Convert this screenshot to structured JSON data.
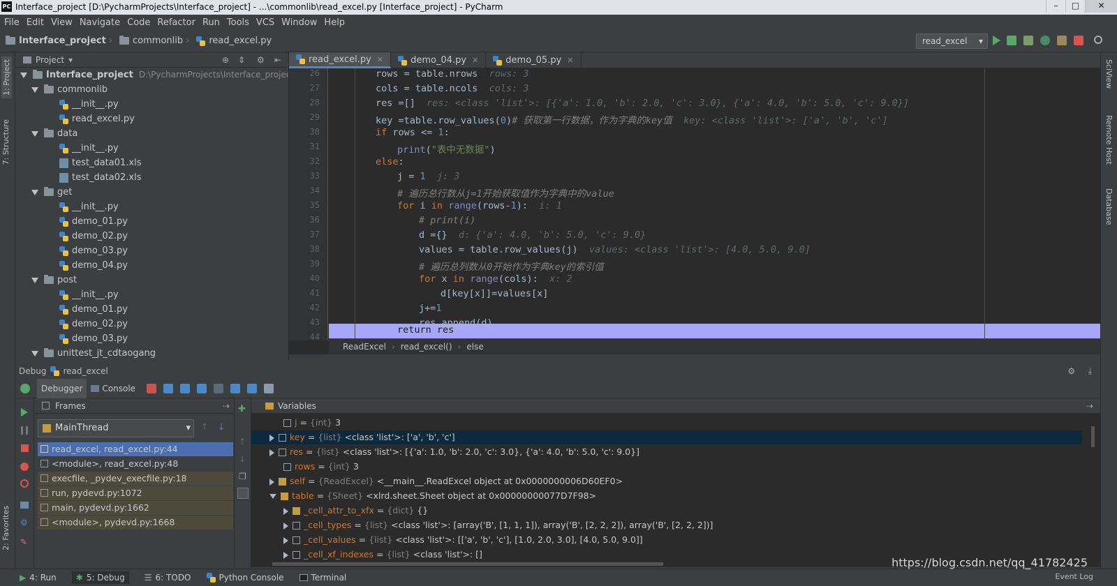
{
  "titlebar": {
    "title": "Interface_project [D:\\PycharmProjects\\Interface_project] - ...\\commonlib\\read_excel.py [Interface_project] - PyCharm",
    "app_badge": "PC"
  },
  "menu": [
    "File",
    "Edit",
    "View",
    "Navigate",
    "Code",
    "Refactor",
    "Run",
    "Tools",
    "VCS",
    "Window",
    "Help"
  ],
  "breadcrumb": [
    "Interface_project",
    "commonlib",
    "read_excel.py"
  ],
  "run_config": "read_excel",
  "project_panel": {
    "title": "Project",
    "tree": [
      {
        "label": "Interface_project",
        "path": "D:\\PycharmProjects\\Interface_project",
        "type": "root"
      },
      {
        "label": "commonlib",
        "type": "folder"
      },
      {
        "label": "__init__.py",
        "type": "py"
      },
      {
        "label": "read_excel.py",
        "type": "py"
      },
      {
        "label": "data",
        "type": "folder"
      },
      {
        "label": "__init__.py",
        "type": "py"
      },
      {
        "label": "test_data01.xls",
        "type": "xls"
      },
      {
        "label": "test_data02.xls",
        "type": "xls"
      },
      {
        "label": "get",
        "type": "folder"
      },
      {
        "label": "__init__.py",
        "type": "py"
      },
      {
        "label": "demo_01.py",
        "type": "py"
      },
      {
        "label": "demo_02.py",
        "type": "py"
      },
      {
        "label": "demo_03.py",
        "type": "py"
      },
      {
        "label": "demo_04.py",
        "type": "py"
      },
      {
        "label": "post",
        "type": "folder"
      },
      {
        "label": "__init__.py",
        "type": "py"
      },
      {
        "label": "demo_01.py",
        "type": "py"
      },
      {
        "label": "demo_02.py",
        "type": "py"
      },
      {
        "label": "demo_03.py",
        "type": "py"
      },
      {
        "label": "unittest_jt_cdtaogang",
        "type": "folder"
      }
    ]
  },
  "editor": {
    "tabs": [
      "read_excel.py",
      "demo_04.py",
      "demo_05.py"
    ],
    "line_numbers": [
      "26",
      "27",
      "28",
      "29",
      "30",
      "31",
      "32",
      "33",
      "34",
      "35",
      "36",
      "37",
      "38",
      "39",
      "40",
      "41",
      "42",
      "43",
      "44"
    ],
    "crumbs": [
      "ReadExcel",
      "read_excel()",
      "else"
    ],
    "code": {
      "l26": "rows = table.nrows",
      "l26h": "rows: 3",
      "l27": "cols = table.ncols",
      "l27h": "cols: 3",
      "l28": "res =[]",
      "l28h": "res: <class 'list'>: [{'a': 1.0, 'b': 2.0, 'c': 3.0}, {'a': 4.0, 'b': 5.0, 'c': 9.0}]",
      "l29a": "key =table.row_values(",
      "l29b": "0",
      "l29c": ")",
      "l29cmt": "# 获取第一行数据，作为字典的key值",
      "l29h": "key: <class 'list'>: ['a', 'b', 'c']",
      "l30a": "if",
      "l30b": " rows <= ",
      "l30c": "1",
      "l30d": ":",
      "l31a": "print",
      "l31b": "(",
      "l31c": "\"表中无数据\"",
      "l31d": ")",
      "l32a": "else",
      "l32b": ":",
      "l33a": "j = ",
      "l33b": "1",
      "l33h": "j: 3",
      "l34cmt": "# 遍历总行数从j=1开始获取值作为字典中的value",
      "l35a": "for",
      "l35b": " i ",
      "l35c": "in",
      "l35d": " ",
      "l35e": "range",
      "l35f": "(rows-",
      "l35g": "1",
      "l35i": "):",
      "l35h": "i: 1",
      "l36cmt": "# print(i)",
      "l37": "d ={}",
      "l37h": "d: {'a': 4.0, 'b': 5.0, 'c': 9.0}",
      "l38": "values = table.row_values(j)",
      "l38h": "values: <class 'list'>: [4.0, 5.0, 9.0]",
      "l39cmt": "# 遍历总列数从0开始作为字典key的索引值",
      "l40a": "for",
      "l40b": " x ",
      "l40c": "in",
      "l40d": " ",
      "l40e": "range",
      "l40f": "(cols):",
      "l40h": "x: 2",
      "l41": "d[key[x]]=values[x]",
      "l42a": "j+=",
      "l42b": "1",
      "l43": "res.append(d)",
      "l44a": "return",
      "l44b": " res"
    }
  },
  "debug": {
    "title": "Debug",
    "config": "read_excel",
    "tabs": [
      "Debugger",
      "Console"
    ],
    "frames_title": "Frames",
    "thread": "MainThread",
    "frames": [
      "read_excel, read_excel.py:44",
      "<module>, read_excel.py:48",
      "execfile, _pydev_execfile.py:18",
      "run, pydevd.py:1072",
      "main, pydevd.py:1662",
      "<module>, pydevd.py:1668"
    ],
    "variables_title": "Variables",
    "variables": [
      {
        "name": "j",
        "type": "{int}",
        "value": "3",
        "depth": 0,
        "expand": "none"
      },
      {
        "name": "key",
        "type": "{list}",
        "value": "<class 'list'>: ['a', 'b', 'c']",
        "depth": 0,
        "expand": "right",
        "selected": true
      },
      {
        "name": "res",
        "type": "{list}",
        "value": "<class 'list'>: [{'a': 1.0, 'b': 2.0, 'c': 3.0}, {'a': 4.0, 'b': 5.0, 'c': 9.0}]",
        "depth": 0,
        "expand": "right"
      },
      {
        "name": "rows",
        "type": "{int}",
        "value": "3",
        "depth": 0,
        "expand": "none"
      },
      {
        "name": "self",
        "type": "{ReadExcel}",
        "value": "<__main__.ReadExcel object at 0x0000000006D60EF0>",
        "depth": 0,
        "expand": "right"
      },
      {
        "name": "table",
        "type": "{Sheet}",
        "value": "<xlrd.sheet.Sheet object at 0x00000000077D7F98>",
        "depth": 0,
        "expand": "down"
      },
      {
        "name": "_cell_attr_to_xfx",
        "type": "{dict}",
        "value": "{}",
        "depth": 1,
        "expand": "right"
      },
      {
        "name": "_cell_types",
        "type": "{list}",
        "value": "<class 'list'>: [array('B', [1, 1, 1]), array('B', [2, 2, 2]), array('B', [2, 2, 2])]",
        "depth": 1,
        "expand": "right"
      },
      {
        "name": "_cell_values",
        "type": "{list}",
        "value": "<class 'list'>: [['a', 'b', 'c'], [1.0, 2.0, 3.0], [4.0, 5.0, 9.0]]",
        "depth": 1,
        "expand": "right"
      },
      {
        "name": "_cell_xf_indexes",
        "type": "{list}",
        "value": "<class 'list'>: []",
        "depth": 1,
        "expand": "right"
      }
    ]
  },
  "left_tool_tabs": [
    "1: Project",
    "7: Structure",
    "2: Favorites"
  ],
  "right_tool_tabs": [
    "SciView",
    "Remote Host",
    "Database"
  ],
  "statusbar": {
    "items": [
      "4: Run",
      "5: Debug",
      "6: TODO",
      "Python Console",
      "Terminal"
    ],
    "watermark": "https://blog.csdn.net/qq_41782425",
    "event_log": "Event Log"
  },
  "colors": {
    "accent": "#4a88c7",
    "highlight_line": "#a7a7f8",
    "keyword": "#cc7832",
    "number": "#6897bb",
    "string": "#6a8759",
    "comment": "#808080"
  }
}
